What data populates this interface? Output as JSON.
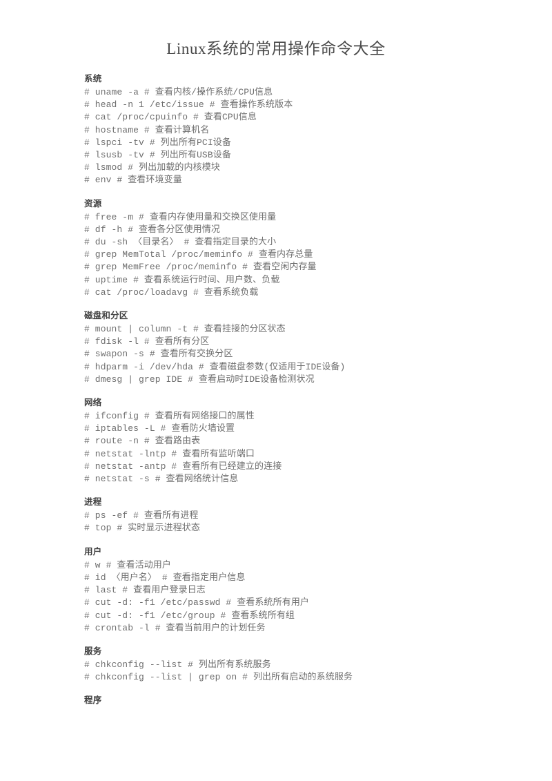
{
  "document": {
    "title": "Linux系统的常用操作命令大全"
  },
  "sections": [
    {
      "heading": "系统",
      "commands": [
        "# uname -a # 查看内核/操作系统/CPU信息",
        "# head -n 1 /etc/issue # 查看操作系统版本",
        "# cat /proc/cpuinfo # 查看CPU信息",
        "# hostname # 查看计算机名",
        "# lspci -tv # 列出所有PCI设备",
        "# lsusb -tv # 列出所有USB设备",
        "# lsmod # 列出加载的内核模块",
        "# env # 查看环境变量"
      ]
    },
    {
      "heading": "资源",
      "commands": [
        "# free -m # 查看内存使用量和交换区使用量",
        "# df -h # 查看各分区使用情况",
        "# du -sh 〈目录名〉 # 查看指定目录的大小",
        "# grep MemTotal /proc/meminfo # 查看内存总量",
        "# grep MemFree /proc/meminfo # 查看空闲内存量",
        "# uptime # 查看系统运行时间、用户数、负载",
        "# cat /proc/loadavg # 查看系统负载"
      ]
    },
    {
      "heading": "磁盘和分区",
      "commands": [
        "# mount | column -t # 查看挂接的分区状态",
        "# fdisk -l # 查看所有分区",
        "# swapon -s # 查看所有交换分区",
        "# hdparm -i /dev/hda # 查看磁盘参数(仅适用于IDE设备)",
        "# dmesg | grep IDE # 查看启动时IDE设备检测状况"
      ]
    },
    {
      "heading": "网络",
      "commands": [
        "# ifconfig # 查看所有网络接口的属性",
        "# iptables -L # 查看防火墙设置",
        "# route -n # 查看路由表",
        "# netstat -lntp # 查看所有监听端口",
        "# netstat -antp # 查看所有已经建立的连接",
        "# netstat -s # 查看网络统计信息"
      ]
    },
    {
      "heading": "进程",
      "commands": [
        "# ps -ef # 查看所有进程",
        "# top # 实时显示进程状态"
      ]
    },
    {
      "heading": "用户",
      "commands": [
        "# w # 查看活动用户",
        "# id 〈用户名〉 # 查看指定用户信息",
        "# last # 查看用户登录日志",
        "# cut -d: -f1 /etc/passwd # 查看系统所有用户",
        "# cut -d: -f1 /etc/group # 查看系统所有组",
        "# crontab -l # 查看当前用户的计划任务"
      ]
    },
    {
      "heading": "服务",
      "commands": [
        "# chkconfig --list # 列出所有系统服务",
        "# chkconfig --list | grep on # 列出所有启动的系统服务"
      ]
    },
    {
      "heading": "程序",
      "commands": []
    }
  ]
}
